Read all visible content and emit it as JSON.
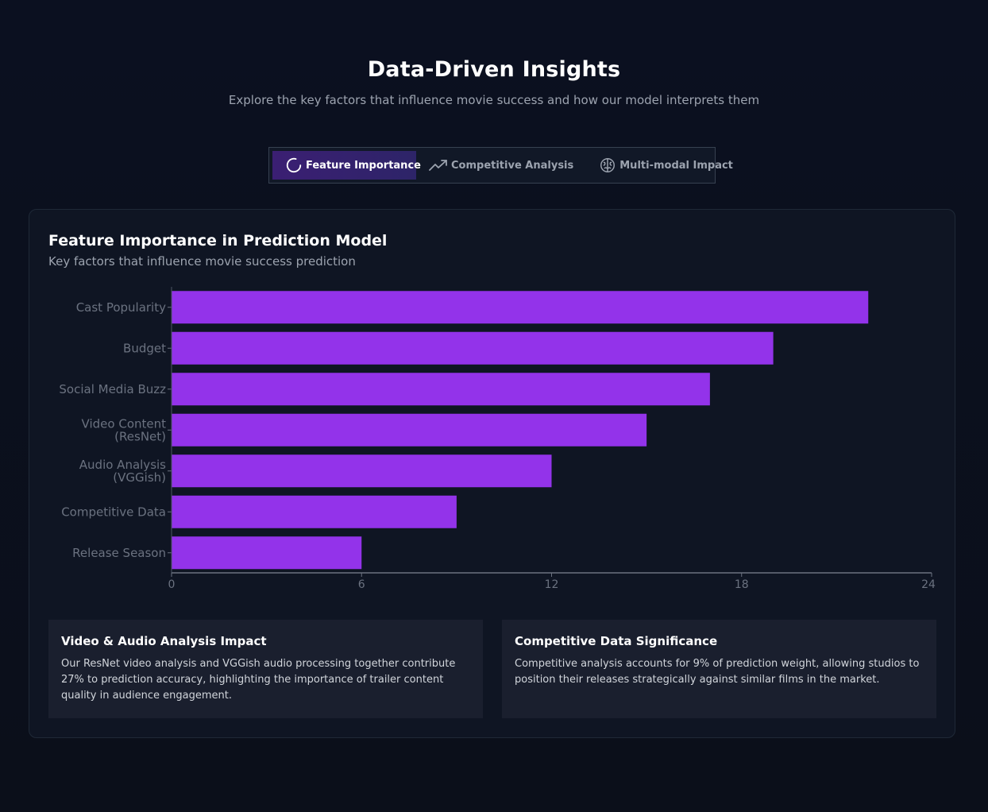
{
  "header": {
    "title": "Data-Driven Insights",
    "subtitle": "Explore the key factors that influence movie success and how our model interprets them"
  },
  "tabs": [
    {
      "label": "Feature Importance",
      "icon": "loader-circle-icon",
      "active": true
    },
    {
      "label": "Competitive Analysis",
      "icon": "trending-up-icon",
      "active": false
    },
    {
      "label": "Multi-modal Impact",
      "icon": "brain-icon",
      "active": false
    }
  ],
  "card": {
    "title": "Feature Importance in Prediction Model",
    "subtitle": "Key factors that influence movie success prediction"
  },
  "chart_data": {
    "type": "bar",
    "orientation": "horizontal",
    "categories": [
      "Cast Popularity",
      "Budget",
      "Social Media Buzz",
      "Video Content (ResNet)",
      "Audio Analysis (VGGish)",
      "Competitive Data",
      "Release Season"
    ],
    "category_lines": [
      [
        "Cast Popularity"
      ],
      [
        "Budget"
      ],
      [
        "Social Media Buzz"
      ],
      [
        "Video Content",
        "(ResNet)"
      ],
      [
        "Audio Analysis",
        "(VGGish)"
      ],
      [
        "Competitive Data"
      ],
      [
        "Release Season"
      ]
    ],
    "values": [
      22,
      19,
      17,
      15,
      12,
      9,
      6
    ],
    "xlim": [
      0,
      24
    ],
    "xticks": [
      "0",
      "6",
      "12",
      "18",
      "24"
    ],
    "grid": false,
    "bar_color": "#9333ea"
  },
  "insights": [
    {
      "title": "Video & Audio Analysis Impact",
      "text": "Our ResNet video analysis and VGGish audio processing together contribute 27% to prediction accuracy, highlighting the importance of trailer content quality in audience engagement."
    },
    {
      "title": "Competitive Data Significance",
      "text": "Competitive analysis accounts for 9% of prediction weight, allowing studios to position their releases strategically against similar films in the market."
    }
  ],
  "colors": {
    "accent": "#9333ea",
    "background": "#0b0f1a",
    "card": "#0f1523",
    "panel": "#1a1f2e"
  }
}
